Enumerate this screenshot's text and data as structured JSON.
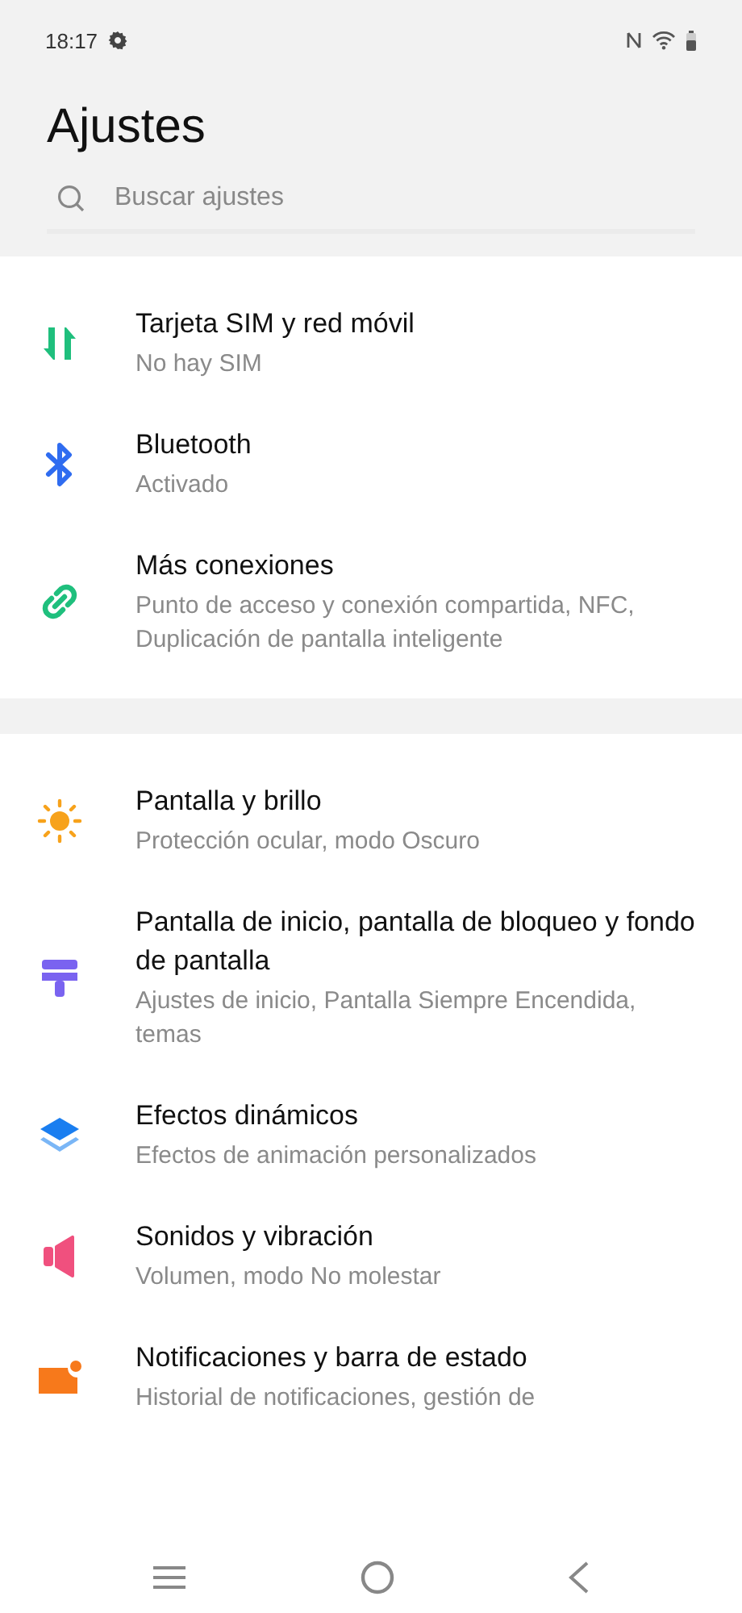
{
  "status_bar": {
    "time": "18:17"
  },
  "title": "Ajustes",
  "search": {
    "placeholder": "Buscar ajustes"
  },
  "groups": [
    {
      "items": [
        {
          "kind": "sim",
          "title": "Tarjeta SIM y red móvil",
          "subtitle": "No hay SIM"
        },
        {
          "kind": "bluetooth",
          "title": "Bluetooth",
          "subtitle": "Activado"
        },
        {
          "kind": "link",
          "title": "Más conexiones",
          "subtitle": "Punto de acceso y conexión compartida, NFC, Duplicación de pantalla inteligente"
        }
      ]
    },
    {
      "items": [
        {
          "kind": "sun",
          "title": "Pantalla y brillo",
          "subtitle": "Protección ocular, modo Oscuro"
        },
        {
          "kind": "wallpaper",
          "title": "Pantalla de inicio, pantalla de bloqueo y fondo de pantalla",
          "subtitle": "Ajustes de inicio, Pantalla Siempre Encendida, temas"
        },
        {
          "kind": "layers",
          "title": "Efectos dinámicos",
          "subtitle": "Efectos de animación personalizados"
        },
        {
          "kind": "sound",
          "title": "Sonidos y vibración",
          "subtitle": "Volumen, modo No molestar"
        },
        {
          "kind": "notification",
          "title": "Notificaciones y barra de estado",
          "subtitle": "Historial de notificaciones, gestión de"
        }
      ]
    }
  ]
}
